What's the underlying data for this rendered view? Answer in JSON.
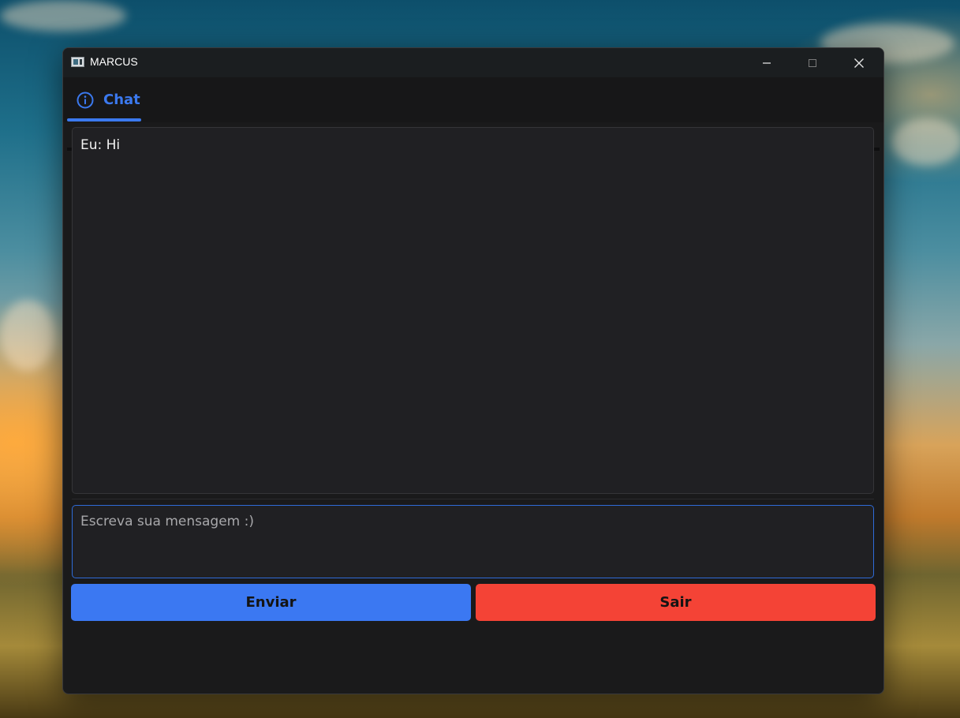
{
  "window": {
    "title": "MARCUS"
  },
  "tabs": [
    {
      "label": "Chat",
      "icon": "info-icon",
      "active": true
    }
  ],
  "chat": {
    "messages": [
      {
        "sender": "Eu",
        "text": "Hi",
        "display": "Eu: Hi"
      }
    ]
  },
  "input": {
    "placeholder": "Escreva sua mensagem :)",
    "value": ""
  },
  "buttons": {
    "send_label": "Enviar",
    "exit_label": "Sair"
  },
  "colors": {
    "accent": "#3b79ef",
    "send_button": "#3b78f2",
    "exit_button": "#f44336",
    "window_bg": "#1a1a1b"
  }
}
